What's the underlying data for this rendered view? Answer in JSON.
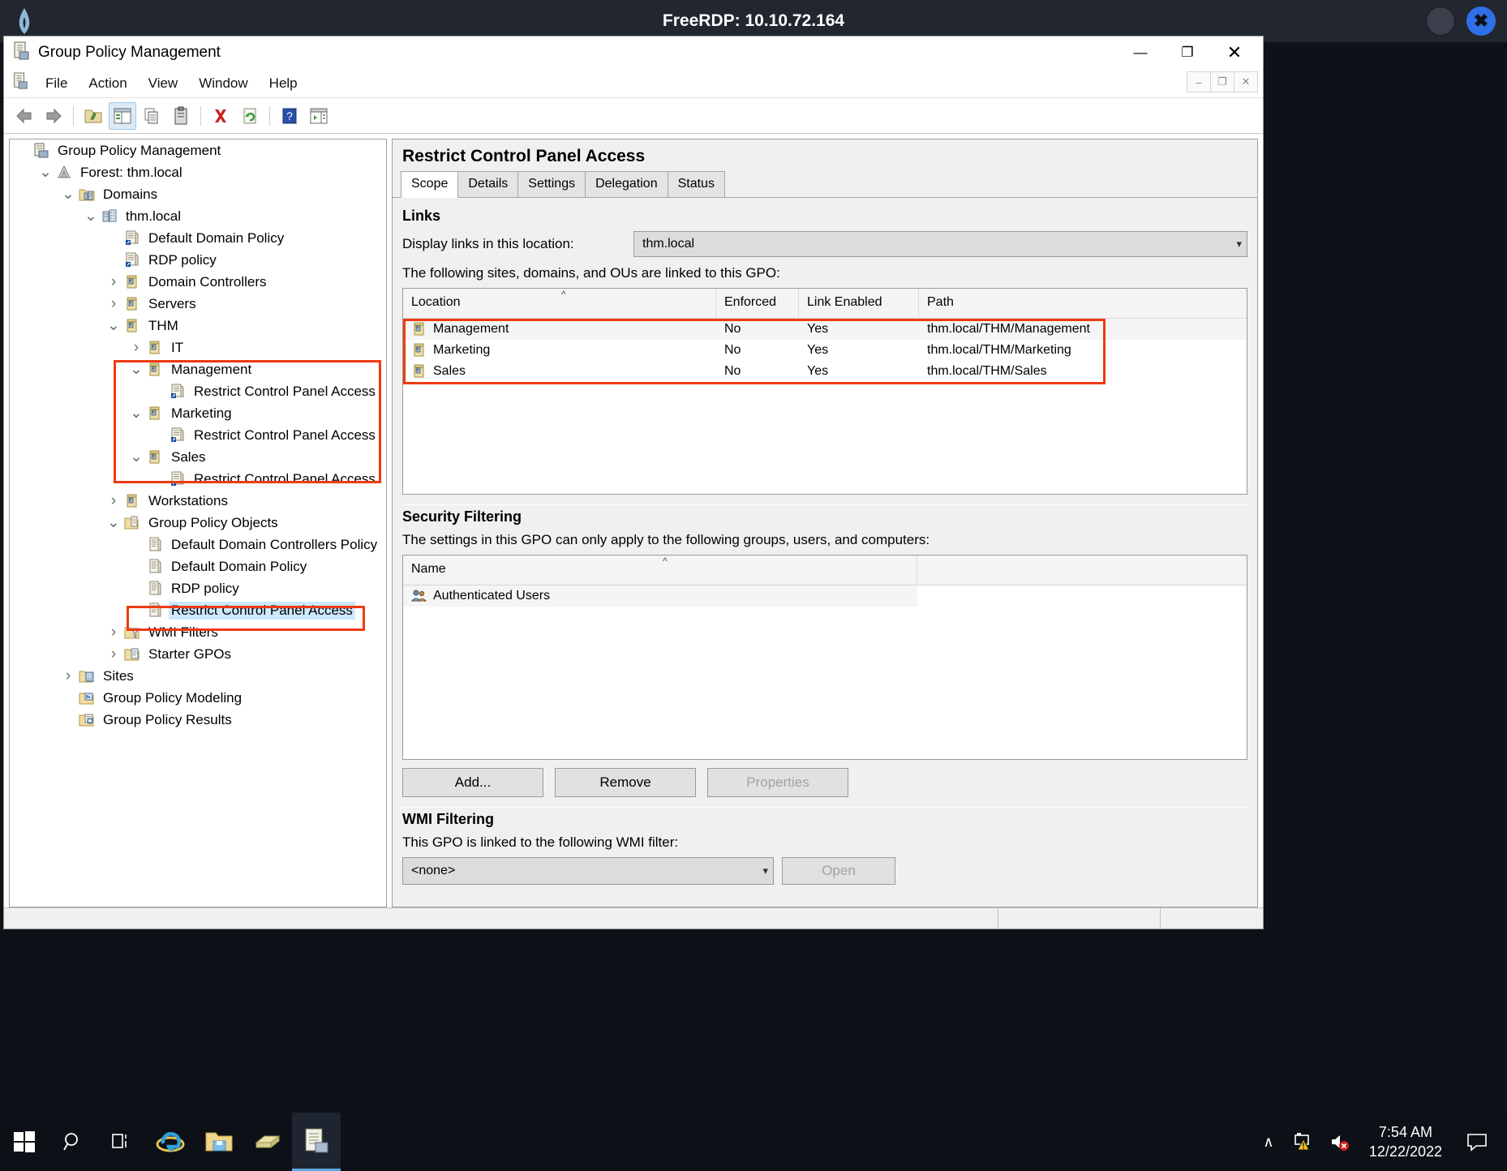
{
  "rdp": {
    "title": "FreeRDP: 10.10.72.164",
    "logo_icon": "freerdp-logo-icon",
    "minimize_icon": "rdp-minimize-icon",
    "close_icon": "rdp-close-icon",
    "accent_color": "#2f6fe8"
  },
  "mmc": {
    "title": "Group Policy Management",
    "app_icon": "mmc-console-icon",
    "window_controls": {
      "minimize": "—",
      "restore": "❐",
      "close": "✕"
    },
    "document_controls": {
      "minimize": "–",
      "restore": "❐",
      "close": "✕"
    },
    "menu": [
      "File",
      "Action",
      "View",
      "Window",
      "Help"
    ],
    "toolbar": [
      {
        "name": "back-icon",
        "glyph": "⇦"
      },
      {
        "name": "forward-icon",
        "glyph": "⇨"
      },
      {
        "name": "up-folder-icon",
        "glyph": "folder"
      },
      {
        "name": "show-hide-tree-icon",
        "glyph": "panel",
        "active": true
      },
      {
        "name": "copy-icon",
        "glyph": "copy"
      },
      {
        "name": "paste-icon",
        "glyph": "paste"
      },
      {
        "name": "delete-icon",
        "glyph": "✖"
      },
      {
        "name": "refresh-icon",
        "glyph": "↻"
      },
      {
        "name": "help-icon",
        "glyph": "?"
      },
      {
        "name": "export-list-icon",
        "glyph": "panel2"
      }
    ]
  },
  "tree": {
    "items": [
      {
        "label": "Group Policy Management",
        "depth": 0,
        "twisty": "",
        "icon": "console-root-icon"
      },
      {
        "label": "Forest: thm.local",
        "depth": 1,
        "twisty": "⌄",
        "icon": "forest-icon"
      },
      {
        "label": "Domains",
        "depth": 2,
        "twisty": "⌄",
        "icon": "domains-folder-icon"
      },
      {
        "label": "thm.local",
        "depth": 3,
        "twisty": "⌄",
        "icon": "domain-icon"
      },
      {
        "label": "Default Domain Policy",
        "depth": 4,
        "twisty": "",
        "icon": "gpo-link-icon"
      },
      {
        "label": "RDP policy",
        "depth": 4,
        "twisty": "",
        "icon": "gpo-link-icon"
      },
      {
        "label": "Domain Controllers",
        "depth": 4,
        "twisty": "›",
        "icon": "ou-icon"
      },
      {
        "label": "Servers",
        "depth": 4,
        "twisty": "›",
        "icon": "ou-icon"
      },
      {
        "label": "THM",
        "depth": 4,
        "twisty": "⌄",
        "icon": "ou-icon"
      },
      {
        "label": "IT",
        "depth": 5,
        "twisty": "›",
        "icon": "ou-icon"
      },
      {
        "label": "Management",
        "depth": 5,
        "twisty": "⌄",
        "icon": "ou-icon"
      },
      {
        "label": "Restrict Control Panel Access",
        "depth": 6,
        "twisty": "",
        "icon": "gpo-link-icon"
      },
      {
        "label": "Marketing",
        "depth": 5,
        "twisty": "⌄",
        "icon": "ou-icon"
      },
      {
        "label": "Restrict Control Panel Access",
        "depth": 6,
        "twisty": "",
        "icon": "gpo-link-icon"
      },
      {
        "label": "Sales",
        "depth": 5,
        "twisty": "⌄",
        "icon": "ou-icon"
      },
      {
        "label": "Restrict Control Panel Access",
        "depth": 6,
        "twisty": "",
        "icon": "gpo-link-icon"
      },
      {
        "label": "Workstations",
        "depth": 4,
        "twisty": "›",
        "icon": "ou-icon"
      },
      {
        "label": "Group Policy Objects",
        "depth": 4,
        "twisty": "⌄",
        "icon": "gpo-container-icon"
      },
      {
        "label": "Default Domain Controllers Policy",
        "depth": 5,
        "twisty": "",
        "icon": "gpo-icon"
      },
      {
        "label": "Default Domain Policy",
        "depth": 5,
        "twisty": "",
        "icon": "gpo-icon"
      },
      {
        "label": "RDP policy",
        "depth": 5,
        "twisty": "",
        "icon": "gpo-icon"
      },
      {
        "label": "Restrict Control Panel Access",
        "depth": 5,
        "twisty": "",
        "icon": "gpo-icon",
        "selected": true
      },
      {
        "label": "WMI Filters",
        "depth": 4,
        "twisty": "›",
        "icon": "wmi-filter-icon"
      },
      {
        "label": "Starter GPOs",
        "depth": 4,
        "twisty": "›",
        "icon": "starter-gpo-icon"
      },
      {
        "label": "Sites",
        "depth": 2,
        "twisty": "›",
        "icon": "sites-icon"
      },
      {
        "label": "Group Policy Modeling",
        "depth": 2,
        "twisty": "",
        "icon": "modeling-icon"
      },
      {
        "label": "Group Policy Results",
        "depth": 2,
        "twisty": "",
        "icon": "results-icon"
      }
    ],
    "annotation_color": "#ee3b11"
  },
  "detail": {
    "gpo_name": "Restrict Control Panel Access",
    "tabs": [
      {
        "label": "Scope",
        "active": true
      },
      {
        "label": "Details",
        "active": false
      },
      {
        "label": "Settings",
        "active": false
      },
      {
        "label": "Delegation",
        "active": false
      },
      {
        "label": "Status",
        "active": false
      }
    ],
    "links": {
      "heading": "Links",
      "location_label": "Display links in this location:",
      "location_value": "thm.local",
      "description": "The following sites, domains, and OUs are linked to this GPO:",
      "columns": [
        "Location",
        "Enforced",
        "Link Enabled",
        "Path"
      ],
      "rows": [
        {
          "location": "Management",
          "enforced": "No",
          "link_enabled": "Yes",
          "path": "thm.local/THM/Management",
          "icon": "ou-icon"
        },
        {
          "location": "Marketing",
          "enforced": "No",
          "link_enabled": "Yes",
          "path": "thm.local/THM/Marketing",
          "icon": "ou-icon"
        },
        {
          "location": "Sales",
          "enforced": "No",
          "link_enabled": "Yes",
          "path": "thm.local/THM/Sales",
          "icon": "ou-icon"
        }
      ]
    },
    "security_filtering": {
      "heading": "Security Filtering",
      "description": "The settings in this GPO can only apply to the following groups, users, and computers:",
      "columns": [
        "Name"
      ],
      "rows": [
        {
          "name": "Authenticated Users",
          "icon": "users-group-icon"
        }
      ],
      "buttons": [
        {
          "label": "Add...",
          "disabled": false
        },
        {
          "label": "Remove",
          "disabled": false
        },
        {
          "label": "Properties",
          "disabled": true
        }
      ]
    },
    "wmi_filtering": {
      "heading": "WMI Filtering",
      "description": "This GPO is linked to the following WMI filter:",
      "filter_value": "<none>",
      "open_button": "Open",
      "open_disabled": true
    }
  },
  "taskbar": {
    "items": [
      {
        "name": "start-button",
        "icon": "windows-logo-icon"
      },
      {
        "name": "search-button",
        "icon": "search-icon"
      },
      {
        "name": "task-view-button",
        "icon": "task-view-icon"
      },
      {
        "name": "internet-explorer-button",
        "icon": "internet-explorer-icon"
      },
      {
        "name": "file-explorer-button",
        "icon": "file-explorer-icon"
      },
      {
        "name": "server-manager-button",
        "icon": "server-manager-icon"
      },
      {
        "name": "gpmc-taskbar-button",
        "icon": "gpmc-icon",
        "active": true
      }
    ],
    "tray": {
      "show_hidden_icons": "∧",
      "network_icon": "network-warning-icon",
      "volume_icon": "volume-muted-icon",
      "time": "7:54 AM",
      "date": "12/22/2022",
      "action_center_icon": "action-center-icon"
    }
  }
}
